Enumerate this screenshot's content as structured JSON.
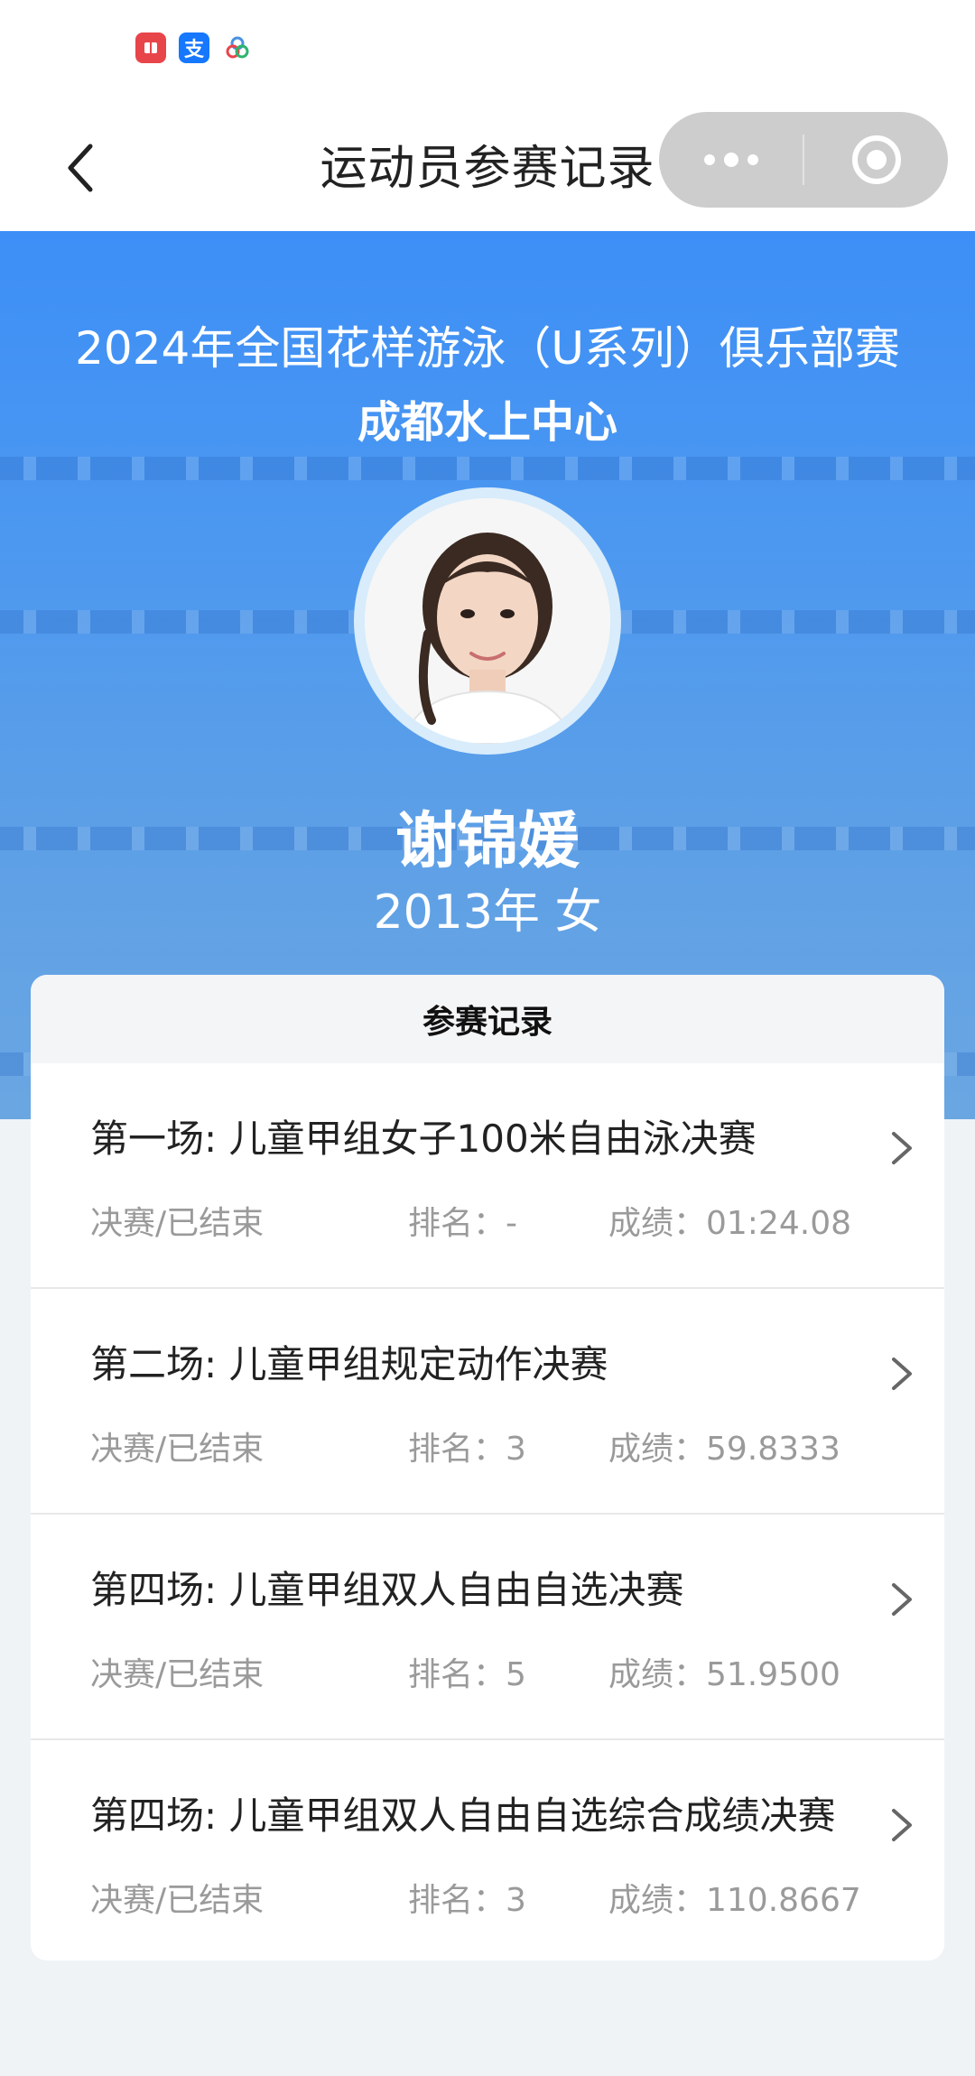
{
  "status_bar": {
    "icons": [
      "red-app-icon",
      "alipay-icon",
      "tricolor-app-icon"
    ],
    "alipay_glyph": "支"
  },
  "nav": {
    "title": "运动员参赛记录"
  },
  "hero": {
    "competition": "2024年全国花样游泳（U系列）俱乐部赛",
    "club": "成都水上中心",
    "athlete_name": "谢锦媛",
    "athlete_info": "2013年 女"
  },
  "records": {
    "header": "参赛记录",
    "items": [
      {
        "title": "第一场: 儿童甲组女子100米自由泳决赛",
        "status": "决赛/已结束",
        "rank": "排名：-",
        "score": "成绩：01:24.08"
      },
      {
        "title": "第二场: 儿童甲组规定动作决赛",
        "status": "决赛/已结束",
        "rank": "排名：3",
        "score": "成绩：59.8333"
      },
      {
        "title": "第四场: 儿童甲组双人自由自选决赛",
        "status": "决赛/已结束",
        "rank": "排名：5",
        "score": "成绩：51.9500"
      },
      {
        "title": "第四场: 儿童甲组双人自由自选综合成绩决赛",
        "status": "决赛/已结束",
        "rank": "排名：3",
        "score": "成绩：110.8667"
      }
    ]
  },
  "colors": {
    "hero_blue": "#3d8ff7",
    "muted_text": "#9a9a9a",
    "page_bg": "#f0f3f6"
  }
}
